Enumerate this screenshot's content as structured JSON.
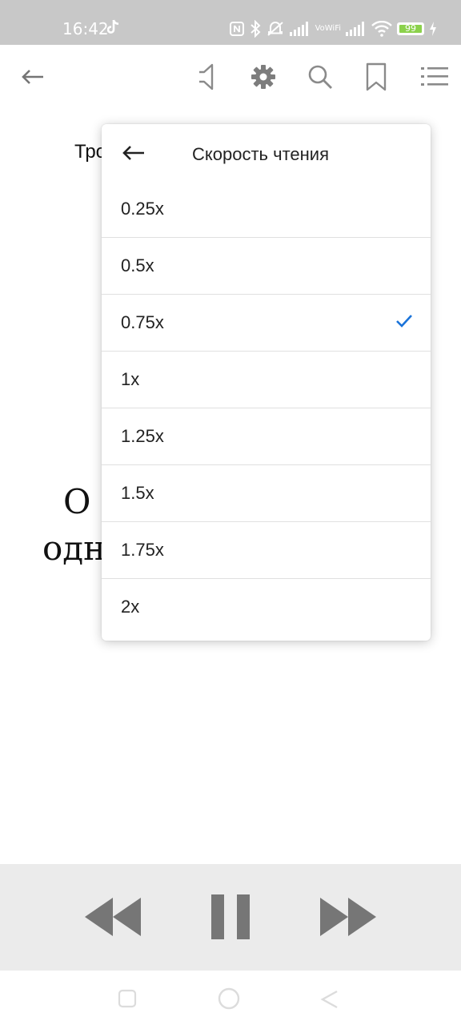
{
  "status_bar": {
    "time": "16:42",
    "vowifi_top": "Vo",
    "vowifi_bottom": "WiFi",
    "battery_percent": "99",
    "icons": [
      "tiktok-icon",
      "nfc-icon",
      "bluetooth-icon",
      "mute-alarm-icon",
      "signal-icon",
      "vowifi-icon",
      "signal-icon",
      "wifi-icon",
      "battery-icon",
      "charging-icon"
    ]
  },
  "toolbar": {
    "icons": [
      "back-arrow-icon",
      "speaker-icon",
      "gear-icon",
      "search-icon",
      "bookmark-icon",
      "list-icon"
    ]
  },
  "reader": {
    "top_text": "Тро",
    "big_line1": "О ",
    "big_line2": "одн"
  },
  "speed_menu": {
    "title": "Скорость чтения",
    "options": [
      {
        "label": "0.25x",
        "selected": false
      },
      {
        "label": "0.5x",
        "selected": false
      },
      {
        "label": "0.75x",
        "selected": true
      },
      {
        "label": "1x",
        "selected": false
      },
      {
        "label": "1.25x",
        "selected": false
      },
      {
        "label": "1.5x",
        "selected": false
      },
      {
        "label": "1.75x",
        "selected": false
      },
      {
        "label": "2x",
        "selected": false
      }
    ],
    "accent_color": "#1a73d9"
  },
  "player": {
    "icons": [
      "rewind-icon",
      "pause-icon",
      "fast-forward-icon"
    ]
  },
  "nav_bar": {
    "icons": [
      "recents-icon",
      "home-icon",
      "back-icon"
    ]
  }
}
